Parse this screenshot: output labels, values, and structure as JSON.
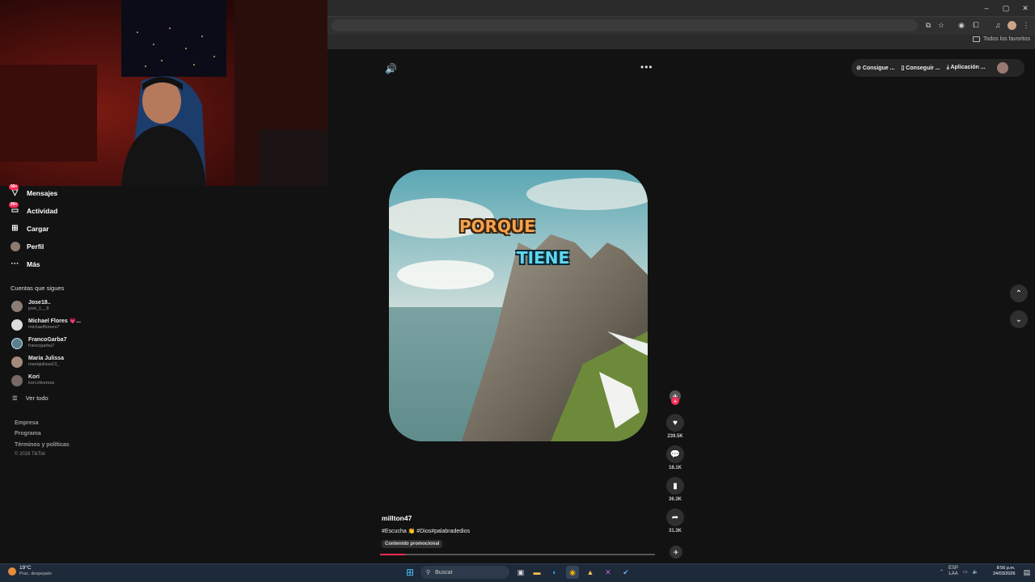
{
  "browser": {
    "window_controls": [
      "–",
      "▢",
      "✕"
    ],
    "bookmarks_label": "Todos los favoritos"
  },
  "sidebar": {
    "nav": [
      {
        "label": "Mensajes",
        "icon": "send-icon",
        "badge": "99+"
      },
      {
        "label": "Actividad",
        "icon": "inbox-icon",
        "badge": "99+"
      },
      {
        "label": "Cargar",
        "icon": "upload-icon"
      },
      {
        "label": "Perfil",
        "icon": "profile-icon"
      },
      {
        "label": "Más",
        "icon": "more-icon"
      }
    ],
    "following_title": "Cuentas que sigues",
    "accounts": [
      {
        "name": "Jose18..",
        "handle": "jose_1__8"
      },
      {
        "name": "Michael Flores 💗...",
        "handle": "michaelflorees7"
      },
      {
        "name": "FrancoGarba7",
        "handle": "francogarba7"
      },
      {
        "name": "Maria Julissa",
        "handle": "mariajulissa13_"
      },
      {
        "name": "Kori",
        "handle": "kori.oliveross"
      }
    ],
    "see_all": "Ver todo",
    "footer": [
      "Empresa",
      "Programa",
      "Términos y políticas"
    ],
    "copyright": "© 2026 TikTok"
  },
  "header_pills": [
    "Consigue ...",
    "Conseguir ...",
    "Aplicación ..."
  ],
  "video": {
    "caption_1": "PORQUE",
    "caption_2": "TIENE",
    "username": "millton47",
    "tags": "#Escucha 👏 #Dios#palabradedios",
    "promo": "Contenido promocional",
    "progress": 0.09
  },
  "actions": {
    "likes": "239.5K",
    "comments": "18.1K",
    "saves": "36.3K",
    "shares": "31.3K"
  },
  "taskbar": {
    "temp": "19°C",
    "weather": "Prac. despejado",
    "search": "Buscar",
    "lang_1": "ESP",
    "lang_2": "LAA",
    "time": "8:56 p.m.",
    "date": "24/03/2026"
  },
  "colors": {
    "accent": "#fe2c55",
    "background": "#121212"
  }
}
